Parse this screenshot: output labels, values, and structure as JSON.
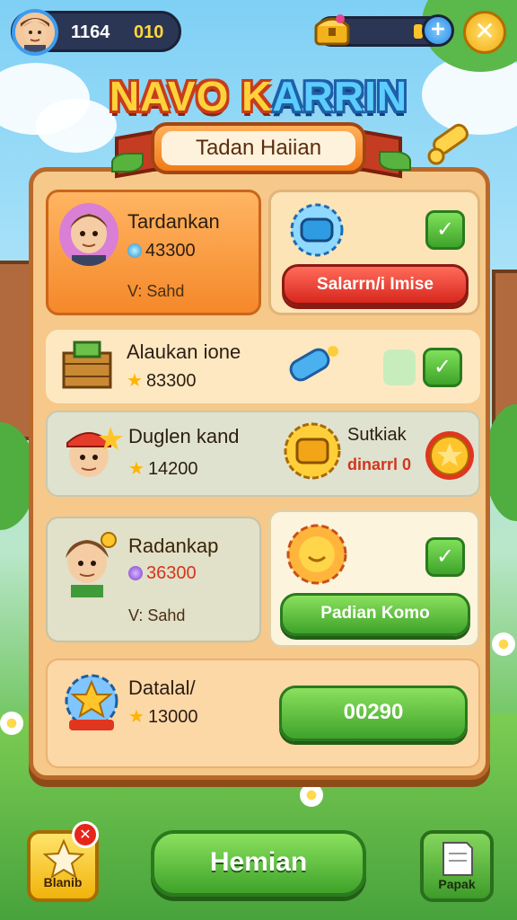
{
  "header": {
    "player_level": "1164",
    "player_coins": "010",
    "title_main": "NAVO K",
    "title_end": "ARRIN",
    "ribbon_label": "Tadan Haiian",
    "plus_label": "+",
    "close_label": "✕"
  },
  "rows": [
    {
      "name": "Tardankan",
      "value": "43300",
      "sub": "V: Sahd",
      "button_label": "Salarrn/i Imise",
      "check_label": "✓"
    },
    {
      "name": "Alaukan ione",
      "value": "83300",
      "check_label": "✓"
    },
    {
      "name": "Duglen kand",
      "value": "14200",
      "side_name": "Sutkiak",
      "side_value": "dinarrl 0"
    },
    {
      "name": "Radankap",
      "value": "36300",
      "sub": "V: Sahd",
      "button_label": "Padian Komo",
      "check_label": "✓"
    },
    {
      "name": "Datalal/",
      "value": "13000",
      "button_label": "00290"
    }
  ],
  "footer": {
    "left_label": "Blanib",
    "left_badge": "✕",
    "main_label": "Hemian",
    "right_label": "Papak"
  },
  "colors": {
    "accent_red": "#d8271d",
    "accent_green": "#3ea32a",
    "panel": "#f6c889"
  }
}
